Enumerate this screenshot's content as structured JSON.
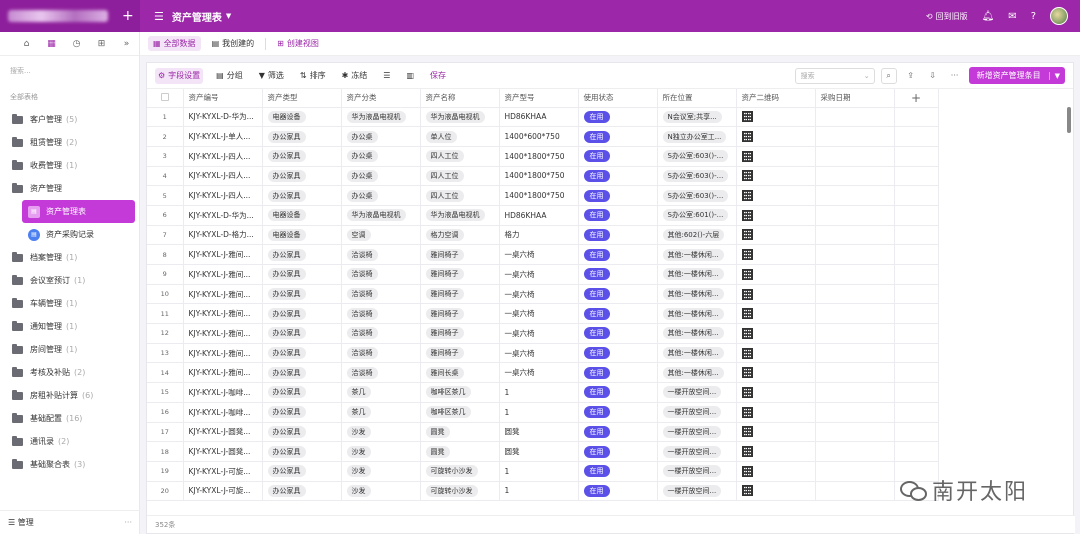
{
  "topbar": {
    "title": "资产管理表",
    "back_old": "回到旧版"
  },
  "sidebar": {
    "tabs": [
      "home-icon",
      "grid-icon",
      "clock-icon",
      "org-icon",
      "collapse-icon"
    ],
    "search_placeholder": "搜索...",
    "section_label": "全部表格",
    "items": [
      {
        "label": "客户管理",
        "count": "(5)"
      },
      {
        "label": "租赁管理",
        "count": "(2)"
      },
      {
        "label": "收费管理",
        "count": "(1)"
      },
      {
        "label": "资产管理",
        "count": ""
      },
      {
        "label": "档案管理",
        "count": "(1)"
      },
      {
        "label": "会议室预订",
        "count": "(1)"
      },
      {
        "label": "车辆管理",
        "count": "(1)"
      },
      {
        "label": "通知管理",
        "count": "(1)"
      },
      {
        "label": "房间管理",
        "count": "(1)"
      },
      {
        "label": "考核及补贴",
        "count": "(2)"
      },
      {
        "label": "房租补贴计算",
        "count": "(6)"
      },
      {
        "label": "基础配置",
        "count": "(16)"
      },
      {
        "label": "通讯录",
        "count": "(2)"
      },
      {
        "label": "基础聚合表",
        "count": "(3)"
      }
    ],
    "subitems": [
      {
        "label": "资产管理表"
      },
      {
        "label": "资产采购记录"
      }
    ],
    "footer_label": "管理"
  },
  "viewbar": {
    "all_data": "全部数据",
    "mine": "我创建的",
    "create_view": "创建视图"
  },
  "toolbar": {
    "field_settings": "字段设置",
    "group": "分组",
    "filter": "筛选",
    "sort": "排序",
    "freeze": "冻结",
    "save": "保存",
    "search_placeholder": "搜索",
    "new_button": "新增资产管理条目"
  },
  "table": {
    "columns": [
      "资产编号",
      "资产类型",
      "资产分类",
      "资产名称",
      "资产型号",
      "使用状态",
      "所在位置",
      "资产二维码",
      "采购日期"
    ],
    "rows": [
      [
        "1",
        "KJY-KYXL-D-华为...",
        "电器设备",
        "华为液晶电视机",
        "华为液晶电视机",
        "HD86KHAA",
        "在用",
        "N会议室;共享..."
      ],
      [
        "2",
        "KJY-KYXL-J-单人...",
        "办公家具",
        "办公桌",
        "单人位",
        "1400*600*750",
        "在用",
        "N独立办公室工..."
      ],
      [
        "3",
        "KJY-KYXL-J-四人...",
        "办公家具",
        "办公桌",
        "四人工位",
        "1400*1800*750",
        "在用",
        "S办公室:603()-..."
      ],
      [
        "4",
        "KJY-KYXL-J-四人...",
        "办公家具",
        "办公桌",
        "四人工位",
        "1400*1800*750",
        "在用",
        "S办公室:603()-..."
      ],
      [
        "5",
        "KJY-KYXL-J-四人...",
        "办公家具",
        "办公桌",
        "四人工位",
        "1400*1800*750",
        "在用",
        "S办公室:603()-..."
      ],
      [
        "6",
        "KJY-KYXL-D-华为...",
        "电器设备",
        "华为液晶电视机",
        "华为液晶电视机",
        "HD86KHAA",
        "在用",
        "S办公室:601()-..."
      ],
      [
        "7",
        "KJY-KYXL-D-格力...",
        "电器设备",
        "空调",
        "格力空调",
        "格力",
        "在用",
        "其他:602()-六层"
      ],
      [
        "8",
        "KJY-KYXL-J-雅间...",
        "办公家具",
        "洽谈椅",
        "雅间椅子",
        "一桌六椅",
        "在用",
        "其他:一楼休闲..."
      ],
      [
        "9",
        "KJY-KYXL-J-雅间...",
        "办公家具",
        "洽谈椅",
        "雅间椅子",
        "一桌六椅",
        "在用",
        "其他:一楼休闲..."
      ],
      [
        "10",
        "KJY-KYXL-J-雅间...",
        "办公家具",
        "洽谈椅",
        "雅间椅子",
        "一桌六椅",
        "在用",
        "其他:一楼休闲..."
      ],
      [
        "11",
        "KJY-KYXL-J-雅间...",
        "办公家具",
        "洽谈椅",
        "雅间椅子",
        "一桌六椅",
        "在用",
        "其他:一楼休闲..."
      ],
      [
        "12",
        "KJY-KYXL-J-雅间...",
        "办公家具",
        "洽谈椅",
        "雅间椅子",
        "一桌六椅",
        "在用",
        "其他:一楼休闲..."
      ],
      [
        "13",
        "KJY-KYXL-J-雅间...",
        "办公家具",
        "洽谈椅",
        "雅间椅子",
        "一桌六椅",
        "在用",
        "其他:一楼休闲..."
      ],
      [
        "14",
        "KJY-KYXL-J-雅间...",
        "办公家具",
        "洽谈椅",
        "雅间长桌",
        "一桌六椅",
        "在用",
        "其他:一楼休闲..."
      ],
      [
        "15",
        "KJY-KYXL-J-咖啡...",
        "办公家具",
        "茶几",
        "咖啡区茶几",
        "1",
        "在用",
        "一楼开放空间..."
      ],
      [
        "16",
        "KJY-KYXL-J-咖啡...",
        "办公家具",
        "茶几",
        "咖啡区茶几",
        "1",
        "在用",
        "一楼开放空间..."
      ],
      [
        "17",
        "KJY-KYXL-J-圆凳...",
        "办公家具",
        "沙发",
        "圆凳",
        "圆凳",
        "在用",
        "一楼开放空间..."
      ],
      [
        "18",
        "KJY-KYXL-J-圆凳...",
        "办公家具",
        "沙发",
        "圆凳",
        "圆凳",
        "在用",
        "一楼开放空间..."
      ],
      [
        "19",
        "KJY-KYXL-J-可旋...",
        "办公家具",
        "沙发",
        "可旋转小沙发",
        "1",
        "在用",
        "一楼开放空间..."
      ],
      [
        "20",
        "KJY-KYXL-J-可旋...",
        "办公家具",
        "沙发",
        "可旋转小沙发",
        "1",
        "在用",
        "一楼开放空间..."
      ]
    ],
    "record_count": "352条"
  },
  "watermark": "南开太阳",
  "colors": {
    "brand": "#9c27a8",
    "accent": "#c33ad8",
    "status": "#5b50e8"
  }
}
